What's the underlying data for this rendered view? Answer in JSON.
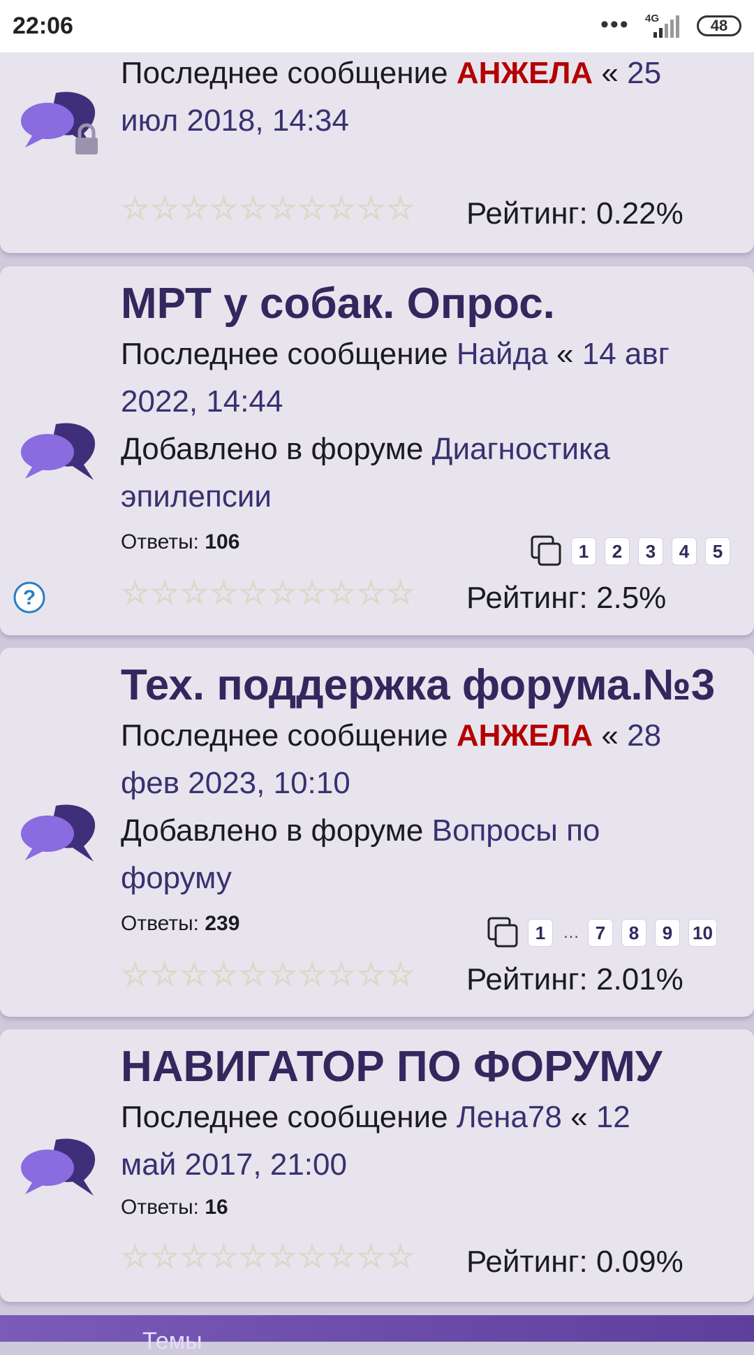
{
  "status_bar": {
    "time": "22:06",
    "dots": "•••",
    "network": "4G",
    "battery": "48"
  },
  "colors": {
    "card_bg": "#e8e4ee",
    "title": "#32285e",
    "link": "#3a3070",
    "admin": "#b30000",
    "page_bg": "#cfc9dc",
    "bottom_bar": "#6a4aa8"
  },
  "labels": {
    "last_message": "Последнее сообщение",
    "added_in": "Добавлено в форуме",
    "replies": "Ответы:",
    "rating": "Рейтинг:",
    "sep": "«"
  },
  "topics": [
    {
      "locked": true,
      "last_user": "АНЖЕЛА",
      "date_line1": "25",
      "date_line2": "июл 2018, 14:34",
      "rating": "0.22%",
      "rating_fraction": 0.0
    },
    {
      "title": "МРТ у собак. Опрос.",
      "last_user": "Найда",
      "date_line1": "14 авг",
      "date_line2": "2022, 14:44",
      "forum_line1": "Диагностика",
      "forum_line2": "эпилепсии",
      "replies": "106",
      "pages": [
        "1",
        "2",
        "3",
        "4",
        "5"
      ],
      "rating": "2.5%",
      "rating_fraction": 0.02,
      "has_poll_icon": true
    },
    {
      "title": "Тех. поддержка форума.№3",
      "last_user": "АНЖЕЛА",
      "date_line1": "28",
      "date_line2": "фев 2023, 10:10",
      "forum_line1": "Вопросы по",
      "forum_line2": "форуму",
      "replies": "239",
      "pages": [
        "1",
        "…",
        "7",
        "8",
        "9",
        "10"
      ],
      "rating": "2.01%",
      "rating_fraction": 0.015
    },
    {
      "title": "НАВИГАТОР ПО ФОРУМУ",
      "last_user": "Лена78",
      "date_line1": "12",
      "date_line2": "май 2017, 21:00",
      "replies": "16",
      "rating": "0.09%",
      "rating_fraction": 0.0
    }
  ],
  "bottom_bar": {
    "label": "Темы"
  },
  "icons": {
    "topic": "speech-bubbles-icon",
    "lock": "lock-icon",
    "pages": "pages-icon",
    "help": "question-icon"
  }
}
